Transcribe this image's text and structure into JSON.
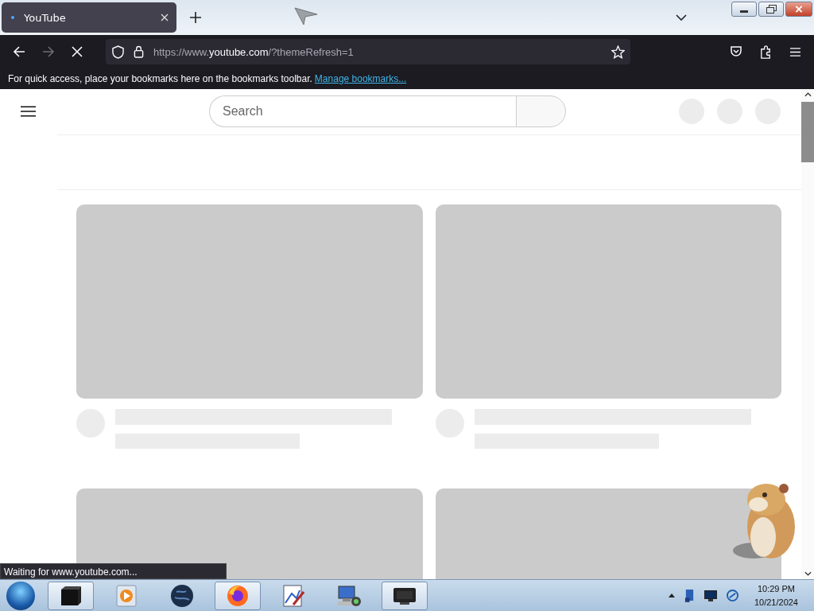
{
  "browser": {
    "tab": {
      "title": "YouTube",
      "selected": true
    },
    "url": {
      "scheme": "https://www.",
      "host": "youtube.com",
      "rest": "/?themeRefresh=1"
    },
    "bookmarks_bar": {
      "message": "For quick access, place your bookmarks here on the bookmarks toolbar.",
      "link": "Manage bookmarks..."
    },
    "status": "Waiting for www.youtube.com..."
  },
  "page": {
    "search": {
      "placeholder": "Search"
    }
  },
  "taskbar": {
    "apps": [
      {
        "kind": "box",
        "running": true
      },
      {
        "kind": "media",
        "running": false
      },
      {
        "kind": "globe",
        "running": false
      },
      {
        "kind": "firefox",
        "running": true
      },
      {
        "kind": "paint",
        "running": false
      },
      {
        "kind": "network",
        "running": false
      },
      {
        "kind": "monitor",
        "running": true
      }
    ],
    "clock": {
      "time": "10:29 PM",
      "date": "10/21/2024"
    }
  }
}
